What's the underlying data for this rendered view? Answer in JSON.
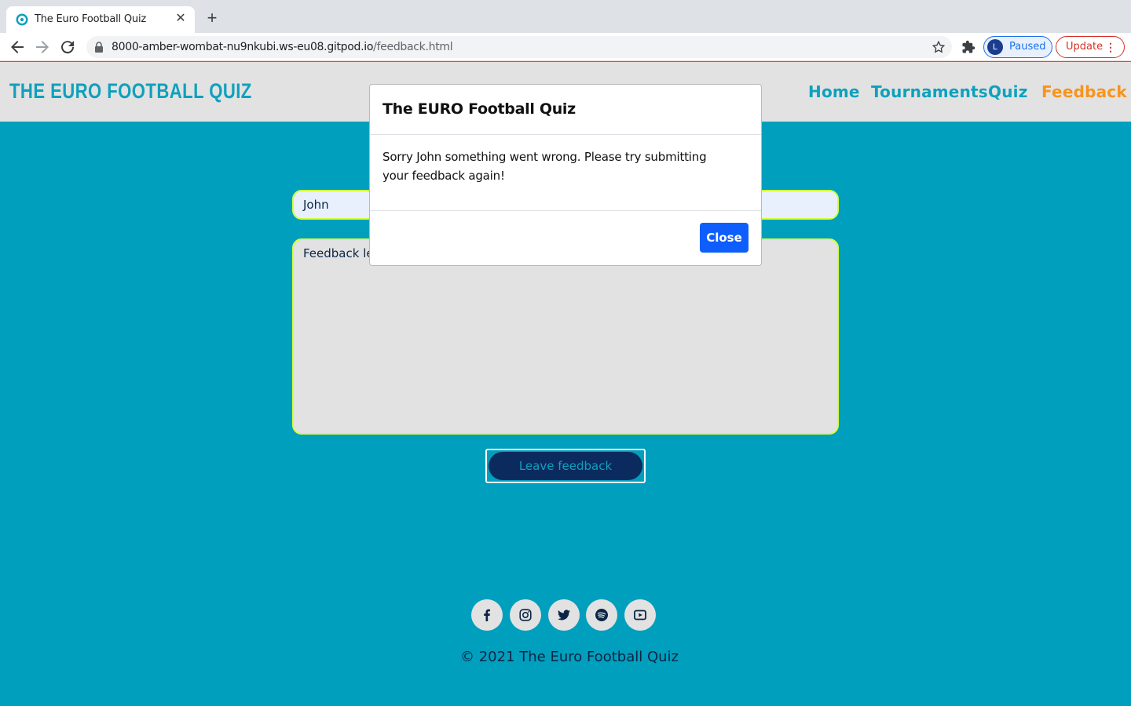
{
  "browser": {
    "tab_title": "The Euro Football Quiz",
    "url_host": "8000-amber-wombat-nu9nkubi.ws-eu08.gitpod.io",
    "url_path": "/feedback.html",
    "profile_initial": "L",
    "profile_label": "Paused",
    "update_label": "Update"
  },
  "site": {
    "logo": "THE EURO FOOTBALL QUIZ",
    "nav": [
      "Home",
      "Tournaments",
      "Quiz",
      "Feedback"
    ],
    "active_nav": "Feedback"
  },
  "form": {
    "name_value": "John",
    "feedback_placeholder": "Feedback left here",
    "submit_label": "Leave feedback"
  },
  "footer": {
    "social_icons": [
      "facebook-icon",
      "instagram-icon",
      "twitter-icon",
      "spotify-icon",
      "youtube-icon"
    ],
    "copyright": "© 2021 The Euro Football Quiz"
  },
  "modal": {
    "title": "The EURO Football Quiz",
    "body": "Sorry John something went wrong. Please try submitting your feedback again!",
    "close_label": "Close"
  },
  "colors": {
    "page_bg": "#009fbd",
    "header_bg": "#e2e2e2",
    "accent": "#0ea1bd",
    "active": "#f7941d",
    "button_dark": "#0b2a5e",
    "modal_button": "#0d5efd"
  }
}
